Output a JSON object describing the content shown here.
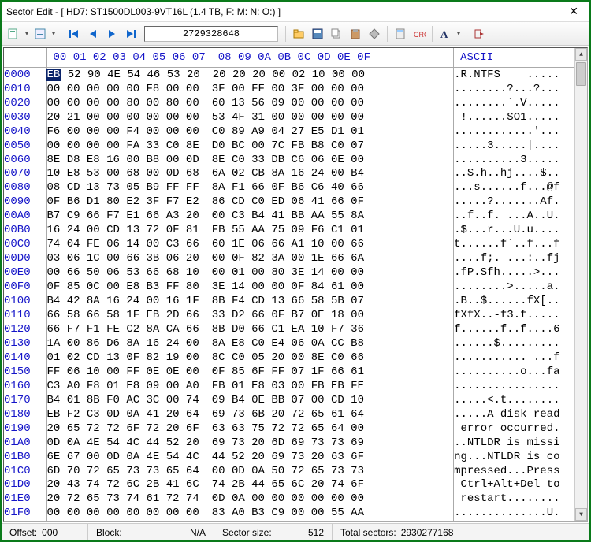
{
  "window": {
    "title": "Sector Edit - [ HD7: ST1500DL003-9VT16L (1.4 TB, F: M: N: O:) ]"
  },
  "toolbar": {
    "sector_value": "2729328648"
  },
  "hex": {
    "col_headers_left": "00 01 02 03 04 05 06 07",
    "col_headers_right": "08 09 0A 0B 0C 0D 0E 0F",
    "ascii_header": "ASCII",
    "rows": [
      {
        "o": "0000",
        "l": "EB 52 90 4E 54 46 53 20",
        "r": "20 20 20 00 02 10 00 00",
        "a": ".R.NTFS    ....."
      },
      {
        "o": "0010",
        "l": "00 00 00 00 00 F8 00 00",
        "r": "3F 00 FF 00 3F 00 00 00",
        "a": "........?...?..."
      },
      {
        "o": "0020",
        "l": "00 00 00 00 80 00 80 00",
        "r": "60 13 56 09 00 00 00 00",
        "a": "........`.V....."
      },
      {
        "o": "0030",
        "l": "20 21 00 00 00 00 00 00",
        "r": "53 4F 31 00 00 00 00 00",
        "a": " !......SO1....."
      },
      {
        "o": "0040",
        "l": "F6 00 00 00 F4 00 00 00",
        "r": "C0 89 A9 04 27 E5 D1 01",
        "a": "............'..."
      },
      {
        "o": "0050",
        "l": "00 00 00 00 FA 33 C0 8E",
        "r": "D0 BC 00 7C FB B8 C0 07",
        "a": ".....3.....|...."
      },
      {
        "o": "0060",
        "l": "8E D8 E8 16 00 B8 00 0D",
        "r": "8E C0 33 DB C6 06 0E 00",
        "a": "..........3....."
      },
      {
        "o": "0070",
        "l": "10 E8 53 00 68 00 0D 68",
        "r": "6A 02 CB 8A 16 24 00 B4",
        "a": "..S.h..hj....$.."
      },
      {
        "o": "0080",
        "l": "08 CD 13 73 05 B9 FF FF",
        "r": "8A F1 66 0F B6 C6 40 66",
        "a": "...s......f...@f"
      },
      {
        "o": "0090",
        "l": "0F B6 D1 80 E2 3F F7 E2",
        "r": "86 CD C0 ED 06 41 66 0F",
        "a": ".....?.......Af."
      },
      {
        "o": "00A0",
        "l": "B7 C9 66 F7 E1 66 A3 20",
        "r": "00 C3 B4 41 BB AA 55 8A",
        "a": "..f..f. ...A..U."
      },
      {
        "o": "00B0",
        "l": "16 24 00 CD 13 72 0F 81",
        "r": "FB 55 AA 75 09 F6 C1 01",
        "a": ".$...r...U.u...."
      },
      {
        "o": "00C0",
        "l": "74 04 FE 06 14 00 C3 66",
        "r": "60 1E 06 66 A1 10 00 66",
        "a": "t......f`..f...f"
      },
      {
        "o": "00D0",
        "l": "03 06 1C 00 66 3B 06 20",
        "r": "00 0F 82 3A 00 1E 66 6A",
        "a": "....f;. ...:..fj"
      },
      {
        "o": "00E0",
        "l": "00 66 50 06 53 66 68 10",
        "r": "00 01 00 80 3E 14 00 00",
        "a": ".fP.Sfh.....>..."
      },
      {
        "o": "00F0",
        "l": "0F 85 0C 00 E8 B3 FF 80",
        "r": "3E 14 00 00 0F 84 61 00",
        "a": "........>.....a."
      },
      {
        "o": "0100",
        "l": "B4 42 8A 16 24 00 16 1F",
        "r": "8B F4 CD 13 66 58 5B 07",
        "a": ".B..$......fX[.."
      },
      {
        "o": "0110",
        "l": "66 58 66 58 1F EB 2D 66",
        "r": "33 D2 66 0F B7 0E 18 00",
        "a": "fXfX..-f3.f....."
      },
      {
        "o": "0120",
        "l": "66 F7 F1 FE C2 8A CA 66",
        "r": "8B D0 66 C1 EA 10 F7 36",
        "a": "f......f..f....6"
      },
      {
        "o": "0130",
        "l": "1A 00 86 D6 8A 16 24 00",
        "r": "8A E8 C0 E4 06 0A CC B8",
        "a": "......$........."
      },
      {
        "o": "0140",
        "l": "01 02 CD 13 0F 82 19 00",
        "r": "8C C0 05 20 00 8E C0 66",
        "a": "........... ...f"
      },
      {
        "o": "0150",
        "l": "FF 06 10 00 FF 0E 0E 00",
        "r": "0F 85 6F FF 07 1F 66 61",
        "a": "..........o...fa"
      },
      {
        "o": "0160",
        "l": "C3 A0 F8 01 E8 09 00 A0",
        "r": "FB 01 E8 03 00 FB EB FE",
        "a": "................"
      },
      {
        "o": "0170",
        "l": "B4 01 8B F0 AC 3C 00 74",
        "r": "09 B4 0E BB 07 00 CD 10",
        "a": ".....<.t........"
      },
      {
        "o": "0180",
        "l": "EB F2 C3 0D 0A 41 20 64",
        "r": "69 73 6B 20 72 65 61 64",
        "a": ".....A disk read"
      },
      {
        "o": "0190",
        "l": "20 65 72 72 6F 72 20 6F",
        "r": "63 63 75 72 72 65 64 00",
        "a": " error occurred."
      },
      {
        "o": "01A0",
        "l": "0D 0A 4E 54 4C 44 52 20",
        "r": "69 73 20 6D 69 73 73 69",
        "a": "..NTLDR is missi"
      },
      {
        "o": "01B0",
        "l": "6E 67 00 0D 0A 4E 54 4C",
        "r": "44 52 20 69 73 20 63 6F",
        "a": "ng...NTLDR is co"
      },
      {
        "o": "01C0",
        "l": "6D 70 72 65 73 73 65 64",
        "r": "00 0D 0A 50 72 65 73 73",
        "a": "mpressed...Press"
      },
      {
        "o": "01D0",
        "l": "20 43 74 72 6C 2B 41 6C",
        "r": "74 2B 44 65 6C 20 74 6F",
        "a": " Ctrl+Alt+Del to"
      },
      {
        "o": "01E0",
        "l": "20 72 65 73 74 61 72 74",
        "r": "0D 0A 00 00 00 00 00 00",
        "a": " restart........"
      },
      {
        "o": "01F0",
        "l": "00 00 00 00 00 00 00 00",
        "r": "83 A0 B3 C9 00 00 55 AA",
        "a": "..............U."
      }
    ]
  },
  "status": {
    "offset_label": "Offset:",
    "offset_value": "000",
    "block_label": "Block:",
    "block_value": "N/A",
    "sector_size_label": "Sector size:",
    "sector_size_value": "512",
    "total_sectors_label": "Total sectors:",
    "total_sectors_value": "2930277168"
  }
}
